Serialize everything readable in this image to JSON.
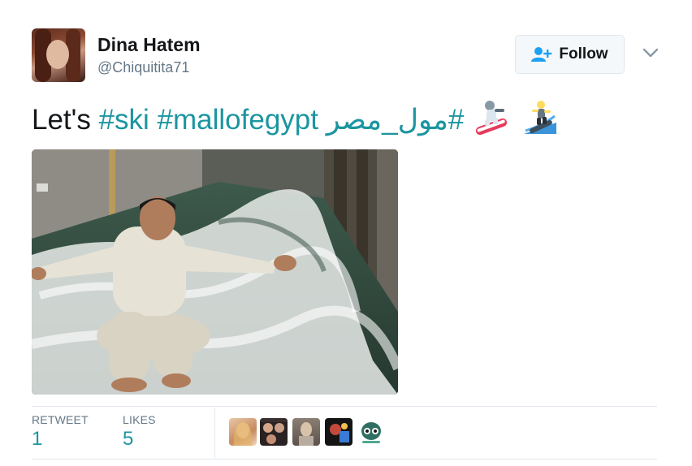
{
  "user": {
    "name": "Dina Hatem",
    "handle": "@Chiquitita71"
  },
  "follow_button": {
    "label": "Follow",
    "icon": "add-user-icon"
  },
  "menu": {
    "icon": "chevron-down-icon"
  },
  "tweet": {
    "prefix": "Let's ",
    "hashtags": [
      "#ski",
      "#mallofegypt",
      "#مول_مصر"
    ],
    "emojis": [
      "snowboarder-emoji",
      "surfer-emoji"
    ]
  },
  "media": {
    "alt_icon": "photo"
  },
  "stats": {
    "retweets_label": "RETWEET",
    "retweets_count": "1",
    "likes_label": "LIKES",
    "likes_count": "5"
  },
  "colors": {
    "hashtag": "#1b95a0",
    "muted": "#657786",
    "border": "#e1e8ed"
  }
}
